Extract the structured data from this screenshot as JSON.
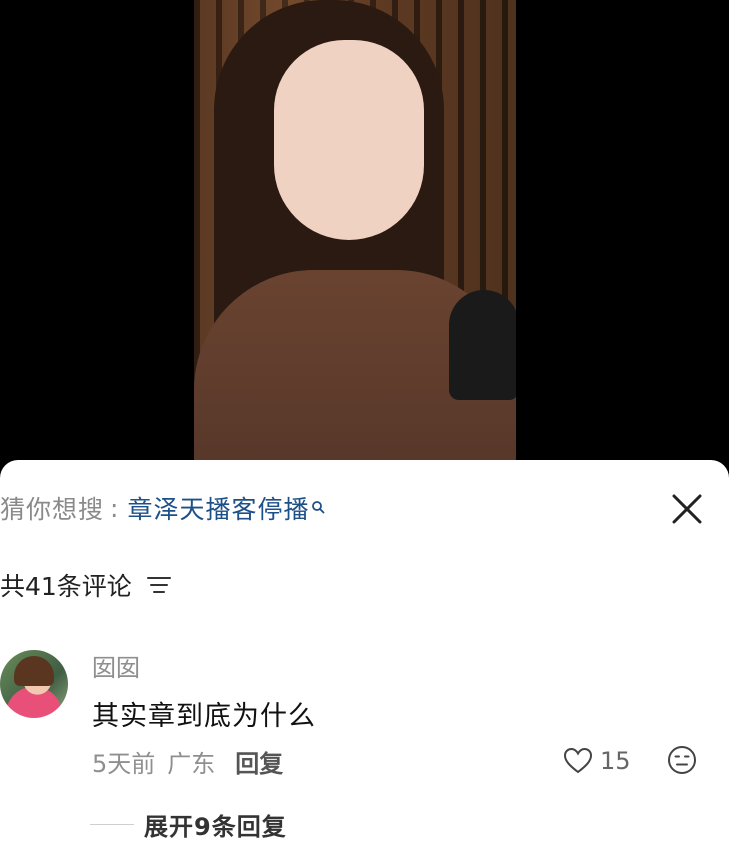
{
  "search_suggest": {
    "prefix": "猜你想搜",
    "separator": ":",
    "term": "章泽天播客停播"
  },
  "comments_header": {
    "count_label": "共41条评论"
  },
  "comment": {
    "username": "囡囡",
    "text": "其实章到底为什么",
    "time": "5天前",
    "location": "广东",
    "reply_label": "回复",
    "like_count": "15",
    "expand_label": "展开9条回复"
  },
  "colors": {
    "link_blue": "#1d4f88",
    "muted_gray": "#8f8f8f"
  }
}
